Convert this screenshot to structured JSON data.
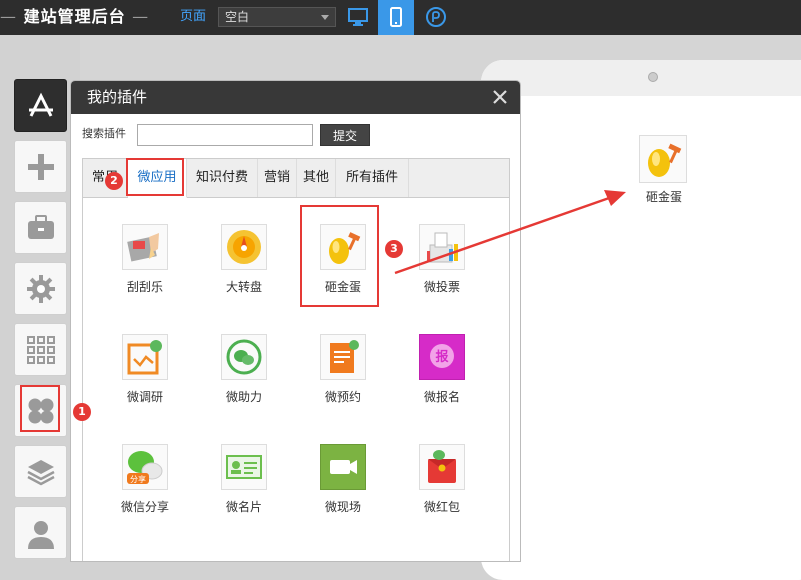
{
  "topbar": {
    "brand_left_dash": "—",
    "brand_title": "建站管理后台",
    "brand_right_dash": "—",
    "page_label": "页面",
    "page_select_value": "空白"
  },
  "dialog": {
    "title": "我的插件",
    "search_label": "搜索插件",
    "search_button": "提交",
    "tabs": [
      "常用",
      "微应用",
      "知识付费",
      "营销",
      "其他",
      "所有插件"
    ],
    "plugins": [
      {
        "label": "刮刮乐",
        "icon": "scratch-card-icon"
      },
      {
        "label": "大转盘",
        "icon": "wheel-icon"
      },
      {
        "label": "砸金蛋",
        "icon": "golden-egg-icon"
      },
      {
        "label": "微投票",
        "icon": "vote-icon"
      },
      {
        "label": "微调研",
        "icon": "survey-icon"
      },
      {
        "label": "微助力",
        "icon": "assist-icon"
      },
      {
        "label": "微预约",
        "icon": "appointment-icon"
      },
      {
        "label": "微报名",
        "icon": "signup-icon"
      },
      {
        "label": "微信分享",
        "icon": "wechat-share-icon"
      },
      {
        "label": "微名片",
        "icon": "card-icon"
      },
      {
        "label": "微现场",
        "icon": "live-icon"
      },
      {
        "label": "微红包",
        "icon": "red-packet-icon"
      }
    ],
    "signup_icon_char": "报",
    "share_tag": "分享"
  },
  "preview": {
    "added_plugin_label": "砸金蛋"
  },
  "badges": {
    "one": "1",
    "two": "2",
    "three": "3"
  },
  "colors": {
    "accent_blue": "#3a98e8",
    "highlight_red": "#e53935",
    "dark_bar": "#2d2d2d"
  }
}
